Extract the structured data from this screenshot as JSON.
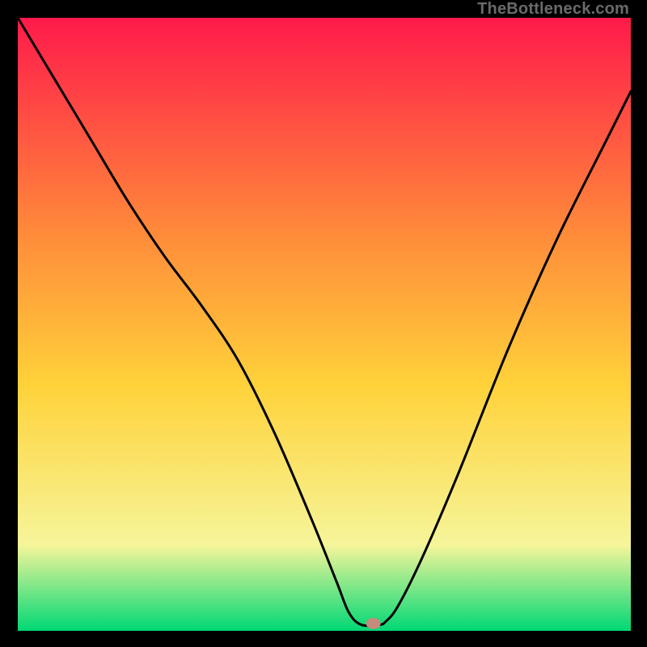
{
  "watermark": "TheBottleneck.com",
  "chart_data": {
    "type": "line",
    "title": "",
    "xlabel": "",
    "ylabel": "",
    "xlim": [
      0,
      100
    ],
    "ylim": [
      0,
      100
    ],
    "grid": false,
    "gradient": {
      "top": "#ff1a4b",
      "upper_mid": "#ff8a3a",
      "mid": "#ffd23a",
      "lower_mid": "#f6f59a",
      "bottom": "#00d875"
    },
    "marker": {
      "x": 58,
      "y": 1.2,
      "color": "#c58b7c"
    },
    "series": [
      {
        "name": "curve",
        "color": "#000000",
        "x": [
          0,
          6,
          12,
          18,
          24,
          30,
          36,
          42,
          48,
          52,
          54,
          56,
          59,
          60,
          62,
          66,
          72,
          80,
          88,
          96,
          100
        ],
        "y": [
          100,
          90,
          80,
          70,
          61,
          53,
          44,
          32,
          18,
          8,
          3,
          1,
          1,
          1.5,
          4,
          12,
          26,
          46,
          64,
          80,
          88
        ]
      }
    ]
  }
}
